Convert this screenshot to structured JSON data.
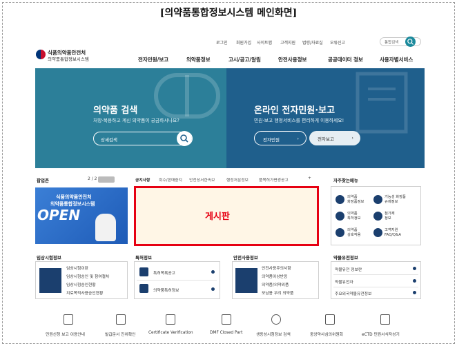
{
  "caption": "[의약품통합정보시스템  메인화면]",
  "utility": [
    "로그인",
    "회원가입",
    "사이트맵",
    "고객지원",
    "법령/자료실",
    "오류신고"
  ],
  "top_search_placeholder": "통합검색",
  "logo": {
    "line1": "식품의약품안전처",
    "line2": "의약품통합정보시스템"
  },
  "gnb": [
    "전자민원/보고",
    "의약품정보",
    "고시/공고/알림",
    "안전사용정보",
    "공공데이터 정보",
    "사용자별서비스"
  ],
  "hero_left": {
    "title": "의약품 검색",
    "subtitle": "처방·복용하고 계신 의약품이 궁금하시나요?",
    "search_placeholder": "상세검색"
  },
  "hero_right": {
    "title": "온라인 전자민원·보고",
    "subtitle": "민원·보고 행정서비스를 편리하게 이용하세요!",
    "buttons": [
      "전자민원",
      "전자보고"
    ]
  },
  "popup": {
    "title": "팝업존",
    "page": "2 / 2",
    "banner_l1": "식품의약품안전처",
    "banner_l2": "의약품통합정보시스템",
    "banner_big": "OPEN"
  },
  "notice": {
    "tabs": [
      "공지사항",
      "회수/판매중지",
      "안전성서한속보",
      "행정처분정보",
      "품목허가변경공고",
      "+"
    ],
    "board_label": "게시판"
  },
  "quick_menu": {
    "title": "자주찾는메뉴",
    "items": [
      "의약품\n화장품정보",
      "기능성 화장품\n규제정보",
      "의약품\n특허정보",
      "첨가제\n정보",
      "의약품\n상호작용",
      "고객지원\nFAQ/Q&A"
    ]
  },
  "sections": [
    {
      "title": "임상시험정보",
      "items": [
        "임상시험이란",
        "임상시험승인 및 참여절차",
        "임상시험승인현황",
        "치료목적사용승인현황"
      ]
    },
    {
      "title": "특허정보",
      "items": [
        "특허목록공고",
        "의약품특허정보"
      ]
    },
    {
      "title": "안전사용정보",
      "items": [
        "안전사용주의사항",
        "의약품이상반응",
        "의약품/의약외품",
        "모남용 우려 의약품"
      ]
    },
    {
      "title": "약물유전정보",
      "items": [
        "약물유전 정보란",
        "약물유전자",
        "주요외국약물유전정보"
      ]
    }
  ],
  "footer": [
    "민원신청 보고 이용안내",
    "발급문서 진위확인",
    "Certificate Verification",
    "DMF Closed Part",
    "생동성시험정보 검색",
    "중앙약사심의위원회",
    "eCTD 민원서식작성기"
  ]
}
